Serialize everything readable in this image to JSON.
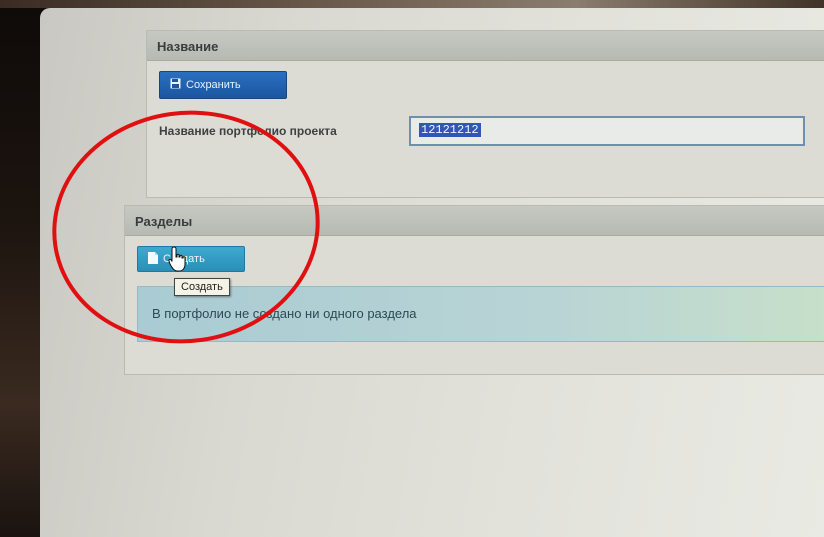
{
  "panel_name": {
    "title": "Название",
    "save_label": "Сохранить",
    "field_label": "Название портфолио проекта",
    "field_value": "12121212"
  },
  "panel_sections": {
    "title": "Разделы",
    "create_label": "Создать",
    "empty_message": "В портфолио не создано ни одного раздела"
  },
  "tooltip": {
    "text": "Создать"
  },
  "colors": {
    "save_button": "#2a6fc0",
    "create_button": "#3ea9cf",
    "annotation_circle": "#e11010"
  },
  "icons": [
    "save-icon",
    "file-icon",
    "hand-cursor-icon"
  ]
}
